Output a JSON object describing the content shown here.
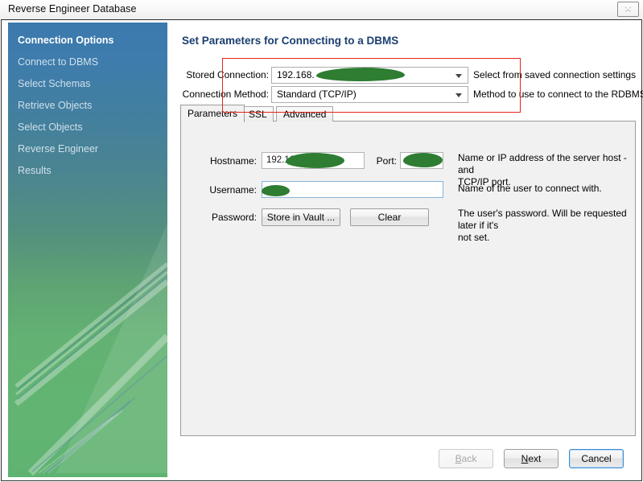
{
  "window": {
    "title": "Reverse Engineer Database",
    "close_label": "✕",
    "close_icon": "close-icon"
  },
  "sidebar": {
    "items": [
      {
        "label": "Connection Options",
        "active": true
      },
      {
        "label": "Connect to DBMS",
        "active": false
      },
      {
        "label": "Select Schemas",
        "active": false
      },
      {
        "label": "Retrieve Objects",
        "active": false
      },
      {
        "label": "Select Objects",
        "active": false
      },
      {
        "label": "Reverse Engineer",
        "active": false
      },
      {
        "label": "Results",
        "active": false
      }
    ],
    "colors": {
      "top": "#3c79ad",
      "bottom": "#5fb371"
    }
  },
  "main": {
    "page_title": "Set Parameters for Connecting to a DBMS",
    "annotation": {
      "color": "#e8241b"
    },
    "stored_connection": {
      "label": "Stored Connection:",
      "value": "192.168.",
      "hint": "Select from saved connection settings",
      "redacted": true
    },
    "connection_method": {
      "label": "Connection Method:",
      "value": "Standard (TCP/IP)",
      "hint": "Method to use to connect to the RDBMS"
    },
    "tabs": [
      {
        "label": "Parameters",
        "selected": true
      },
      {
        "label": "SSL",
        "selected": false
      },
      {
        "label": "Advanced",
        "selected": false
      }
    ],
    "parameters": {
      "hostname": {
        "label": "Hostname:",
        "value": "192.168",
        "redacted": true
      },
      "port": {
        "label": "Port:",
        "value": "",
        "redacted": true
      },
      "host_desc": "Name or IP address of the server host - and\nTCP/IP port.",
      "username": {
        "label": "Username:",
        "value": "",
        "redacted": true
      },
      "username_desc": "Name of the user to connect with.",
      "password": {
        "label": "Password:",
        "store_button": "Store in Vault ...",
        "clear_button": "Clear"
      },
      "password_desc": "The user's password. Will be requested later if it's\nnot set."
    }
  },
  "footer": {
    "back": {
      "label": "Back",
      "mnemonic": "B",
      "rest": "ack",
      "disabled": true
    },
    "next": {
      "label": "Next",
      "mnemonic": "N",
      "rest": "ext",
      "disabled": false
    },
    "cancel": {
      "label": "Cancel",
      "disabled": false
    }
  }
}
